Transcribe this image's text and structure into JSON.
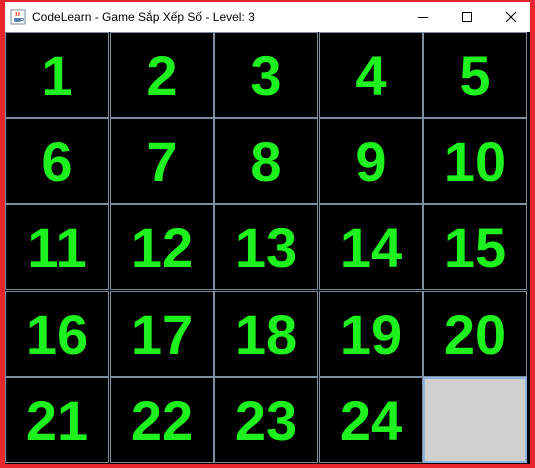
{
  "window": {
    "title": "CodeLearn - Game Sắp Xếp Số - Level: 3",
    "app_icon": "java-cup-icon",
    "controls": [
      "minimize-icon",
      "maximize-icon",
      "close-icon"
    ]
  },
  "game": {
    "level": 3,
    "grid_size": 5,
    "colors": {
      "tile_background": "#000000",
      "tile_text": "#1ef21e",
      "tile_border": "#7d8ea0",
      "empty_tile": "#cfcfcf",
      "frame": "#e6262b"
    },
    "tiles": [
      [
        "1",
        "2",
        "3",
        "4",
        "5"
      ],
      [
        "6",
        "7",
        "8",
        "9",
        "10"
      ],
      [
        "11",
        "12",
        "13",
        "14",
        "15"
      ],
      [
        "16",
        "17",
        "18",
        "19",
        "20"
      ],
      [
        "21",
        "22",
        "23",
        "24",
        ""
      ]
    ]
  }
}
